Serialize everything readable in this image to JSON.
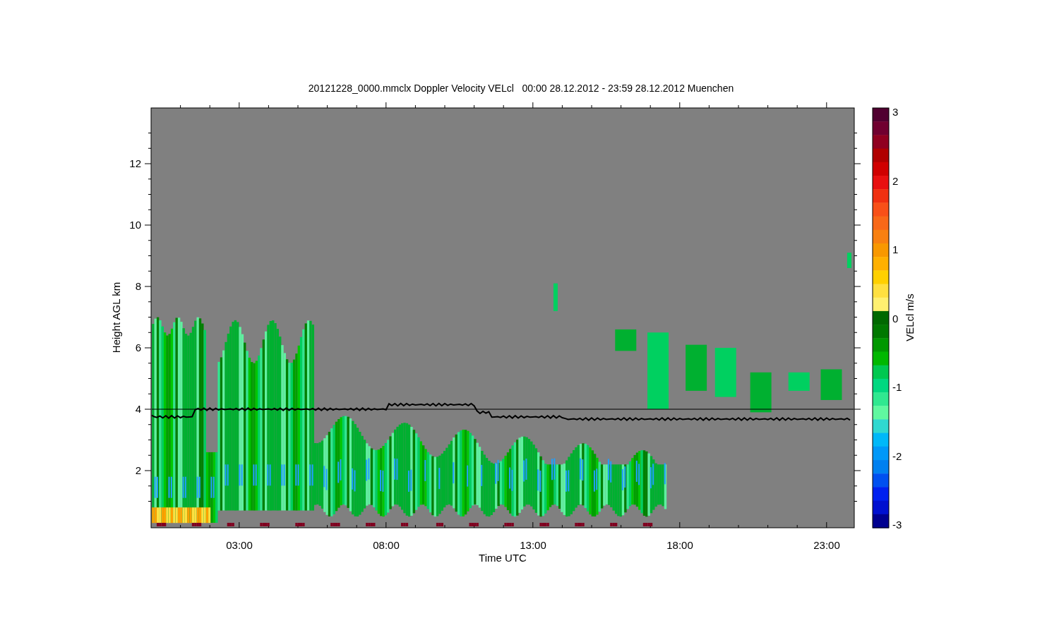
{
  "title": "20121228_0000.mmclx Doppler Velocity VELcl   00:00 28.12.2012 - 23:59 28.12.2012 Muenchen",
  "plot": {
    "xlabel": "Time UTC",
    "ylabel": "Height AGL km",
    "xtick_labels": [
      "03:00",
      "08:00",
      "13:00",
      "18:00",
      "23:00"
    ],
    "ytick_labels": [
      "12",
      "10",
      "8",
      "6",
      "4",
      "2"
    ]
  },
  "colorbar": {
    "label": "VELcl m/s",
    "tick_labels": [
      "3",
      "2",
      "1",
      "0",
      "-1",
      "-2",
      "-3"
    ]
  }
}
